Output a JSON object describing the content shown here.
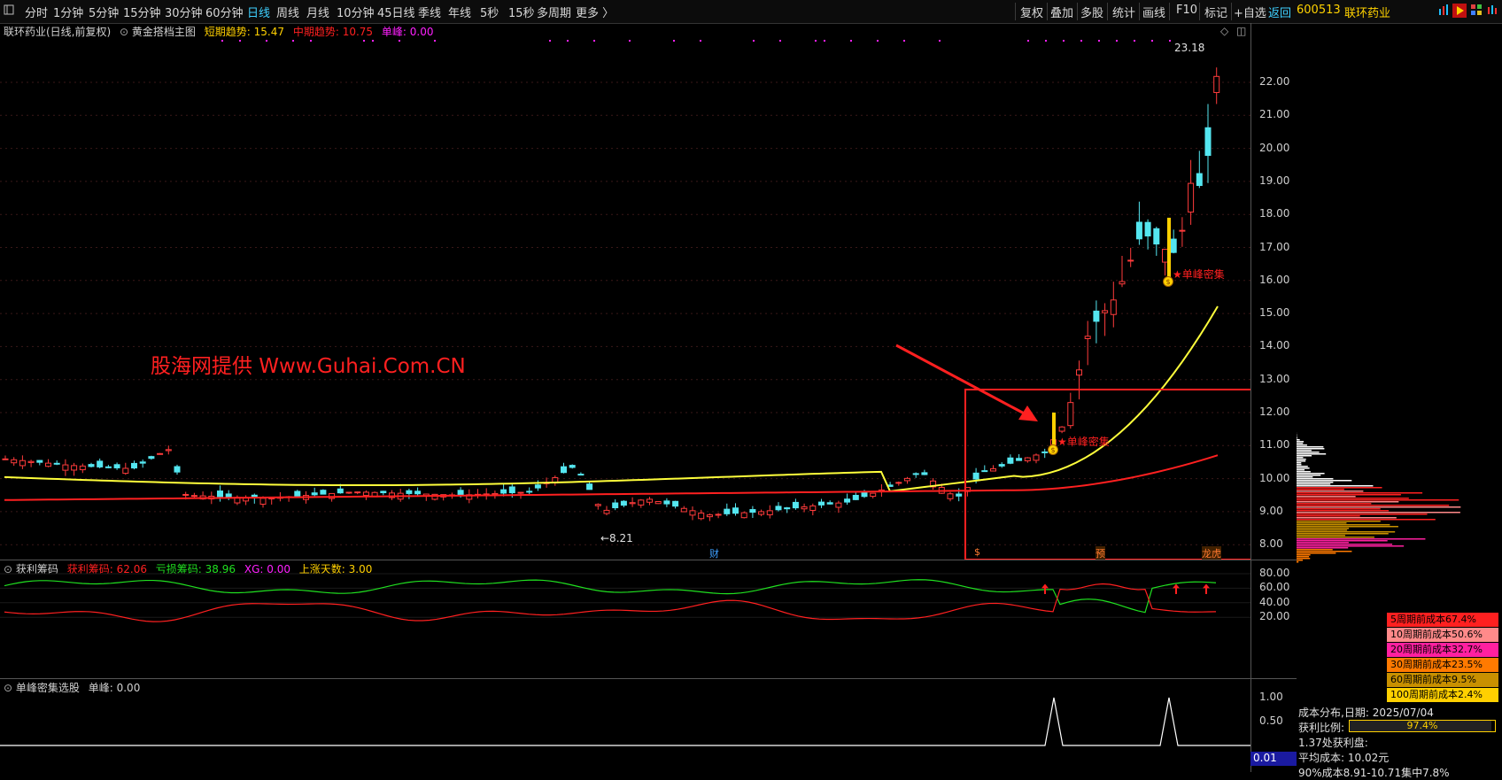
{
  "toolbar": {
    "periods": [
      "分时",
      "1分钟",
      "5分钟",
      "15分钟",
      "30分钟",
      "60分钟",
      "日线",
      "周线",
      "月线",
      "10分钟",
      "45日线",
      "季线",
      "年线",
      "5秒",
      "15秒",
      "多周期",
      "更多 〉"
    ],
    "active_period": "日线",
    "right_items": [
      "复权",
      "叠加",
      "多股",
      "统计",
      "画线",
      "F10",
      "标记",
      "+自选",
      "返回"
    ],
    "stock_code": "600513",
    "stock_name": "联环药业"
  },
  "main_panel": {
    "title": "联环药业(日线,前复权)",
    "indicator_name": "黄金搭档主图",
    "short_trend_label": "短期趋势:",
    "short_trend_value": "15.47",
    "mid_trend_label": "中期趋势:",
    "mid_trend_value": "10.75",
    "single_peak_label": "单峰:",
    "single_peak_value": "0.00",
    "watermark": "股海网提供 Www.Guhai.Com.CN",
    "high_label": "23.18",
    "low_label": "←8.21",
    "annotation_1": "★单峰密集",
    "annotation_2": "★单峰密集",
    "markers": [
      "财",
      "$",
      "预",
      "龙虎"
    ],
    "y_ticks": [
      "22.00",
      "21.00",
      "20.00",
      "19.00",
      "18.00",
      "17.00",
      "16.00",
      "15.00",
      "14.00",
      "13.00",
      "12.00",
      "11.00",
      "10.00",
      "9.00",
      "8.00"
    ]
  },
  "profit_panel": {
    "title": "获利筹码",
    "profit_label": "获利筹码:",
    "profit_value": "62.06",
    "loss_label": "亏损筹码:",
    "loss_value": "38.96",
    "xg_label": "XG:",
    "xg_value": "0.00",
    "rise_days_label": "上涨天数:",
    "rise_days_value": "3.00",
    "y_ticks": [
      "80.00",
      "60.00",
      "40.00",
      "20.00"
    ]
  },
  "peak_panel": {
    "title": "单峰密集选股",
    "peak_label": "单峰:",
    "peak_value": "0.00",
    "y_ticks": [
      "1.00",
      "0.50"
    ],
    "current_value": "0.01"
  },
  "cost_distribution": {
    "legend": [
      {
        "label": "5周期前成本67.4%",
        "color": "#ff2020"
      },
      {
        "label": "10周期前成本50.6%",
        "color": "#ff8a8a"
      },
      {
        "label": "20周期前成本32.7%",
        "color": "#ff20a0"
      },
      {
        "label": "30周期前成本23.5%",
        "color": "#ff7a00"
      },
      {
        "label": "60周期前成本9.5%",
        "color": "#c89000"
      },
      {
        "label": "100周期前成本2.4%",
        "color": "#ffd000"
      }
    ],
    "date_label": "成本分布,日期:",
    "date_value": "2025/07/04",
    "profit_ratio_label": "获利比例:",
    "profit_ratio_value": "97.4%",
    "profit_ratio": 0.974,
    "profit_line": "1.37处获利盘:",
    "avg_cost_label": "平均成本:",
    "avg_cost_value": "10.02元",
    "range_line": "90%成本8.91-10.71集中7.8%"
  },
  "colors": {
    "up": "#ff3b3b",
    "down": "#54e6f0",
    "short_ma": "#ffff3b",
    "mid_ma": "#ff2020",
    "profit_line": "#ff2020",
    "loss_line": "#20e020"
  }
}
